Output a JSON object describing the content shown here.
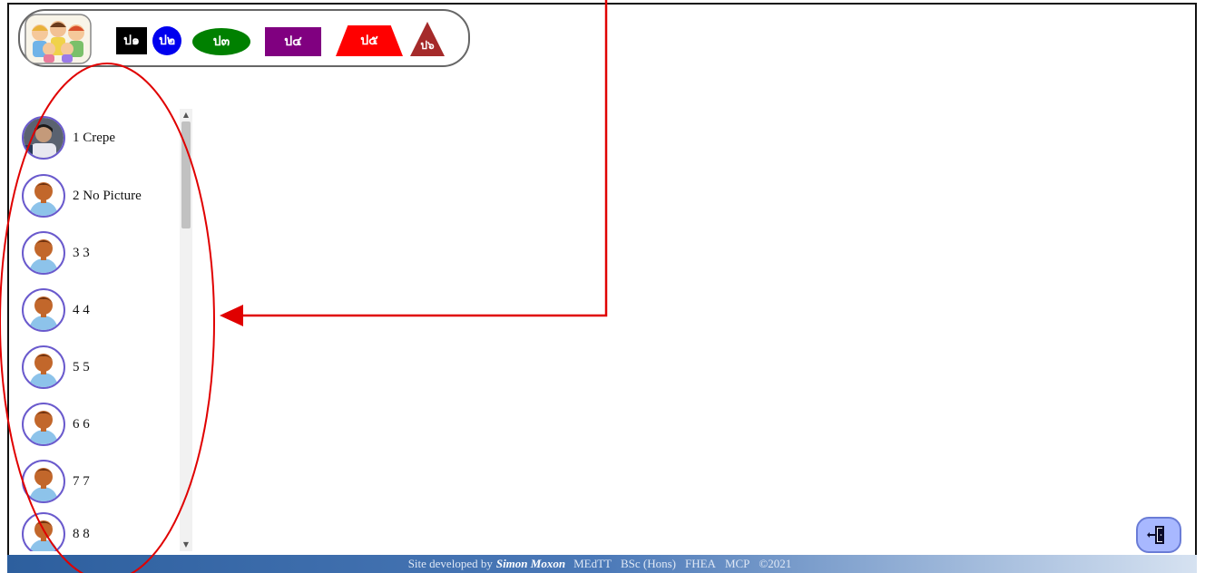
{
  "levels": [
    {
      "label": "ป๑",
      "color": "#000000",
      "shape": "square"
    },
    {
      "label": "ป๒",
      "color": "#0000ee",
      "shape": "circle"
    },
    {
      "label": "ป๓",
      "color": "#008000",
      "shape": "ellipse"
    },
    {
      "label": "ป๔",
      "color": "#800080",
      "shape": "rectangle"
    },
    {
      "label": "ป๕",
      "color": "#ff0000",
      "shape": "trapezoid"
    },
    {
      "label": "ป๖",
      "color": "#a52a2a",
      "shape": "triangle"
    }
  ],
  "students": [
    {
      "label": "1 Crepe",
      "avatar": "photo"
    },
    {
      "label": "2 No Picture",
      "avatar": "default-boy"
    },
    {
      "label": "3 3",
      "avatar": "default-boy"
    },
    {
      "label": "4 4",
      "avatar": "default-boy"
    },
    {
      "label": "5 5",
      "avatar": "default-boy"
    },
    {
      "label": "6 6",
      "avatar": "default-boy"
    },
    {
      "label": "7 7",
      "avatar": "default-boy"
    },
    {
      "label": "8 8",
      "avatar": "default-boy"
    }
  ],
  "footer": {
    "prefix": "Site developed by",
    "author": "Simon Moxon",
    "credentials": [
      "MEdTT",
      "BSc (Hons)",
      "FHEA",
      "MCP",
      "©2021"
    ]
  },
  "colors": {
    "annotation": "#e00000",
    "footer_start": "#2d5f9e",
    "exit_button": "#a8b8ff"
  },
  "icons": {
    "logo": "children-group-logo",
    "exit": "exit-door-icon"
  }
}
